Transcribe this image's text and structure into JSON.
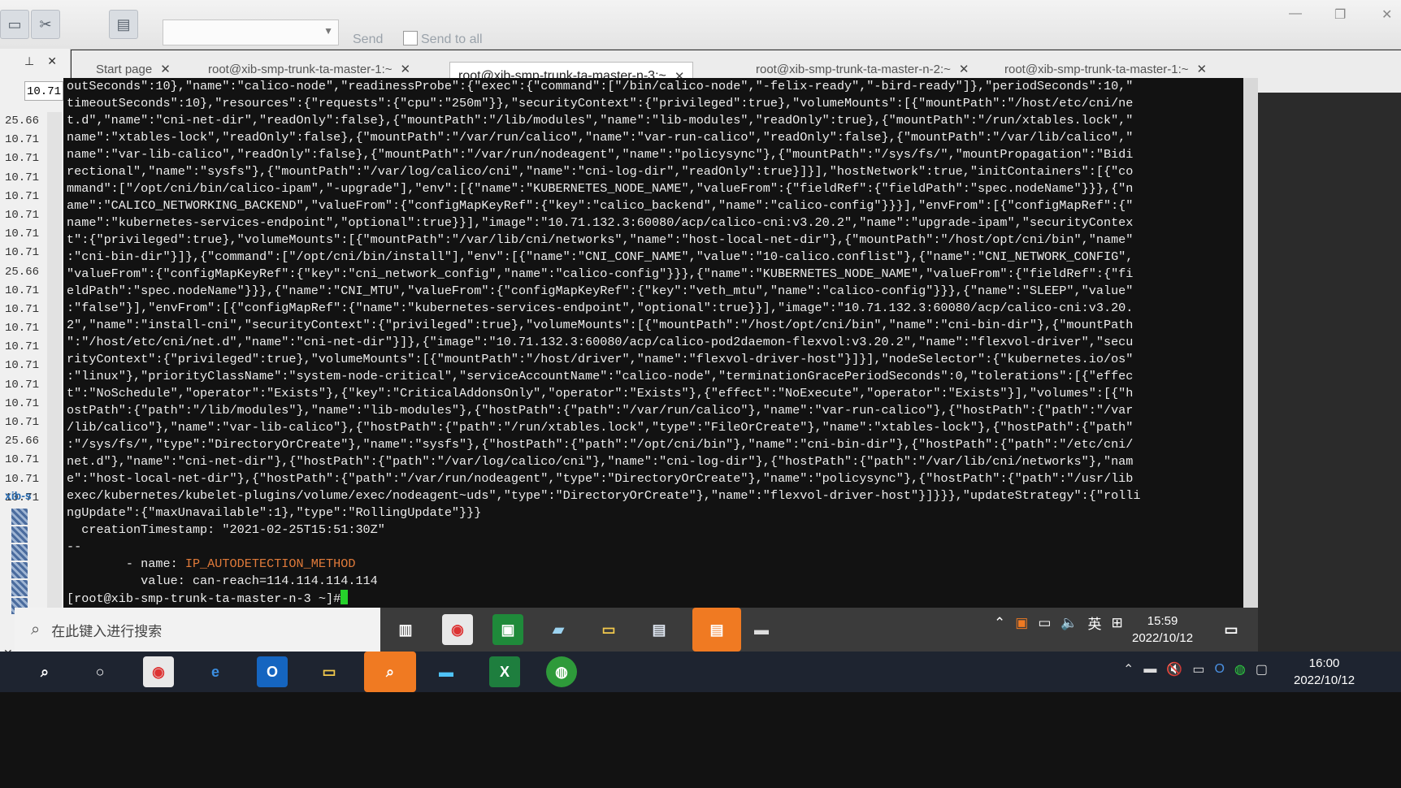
{
  "toolbar": {
    "send_label": "Send",
    "send_to_all_label": "Send to all"
  },
  "tabs": [
    {
      "label": "Start page"
    },
    {
      "label": "root@xib-smp-trunk-ta-master-1:~"
    },
    {
      "label": "root@xib-smp-trunk-ta-master-n-3:~"
    },
    {
      "label": "root@xib-smp-trunk-ta-master-n-2:~"
    },
    {
      "label": "root@xib-smp-trunk-ta-master-1:~"
    }
  ],
  "left_panel": {
    "input_value": "10.71",
    "items": [
      "25.66",
      "10.71",
      "10.71",
      "10.71",
      "10.71",
      "10.71",
      "10.71",
      "10.71",
      "25.66",
      "10.71",
      "10.71",
      "10.71",
      "10.71",
      "10.71",
      "10.71",
      "10.71",
      "10.71",
      "25.66",
      "10.71",
      "10.71",
      "10.71"
    ],
    "host_label": "xib-s"
  },
  "terminal": {
    "lines": [
      "outSeconds\":10},\"name\":\"calico-node\",\"readinessProbe\":{\"exec\":{\"command\":[\"/bin/calico-node\",\"-felix-ready\",\"-bird-ready\"]},\"periodSeconds\":10,\"",
      "timeoutSeconds\":10},\"resources\":{\"requests\":{\"cpu\":\"250m\"}},\"securityContext\":{\"privileged\":true},\"volumeMounts\":[{\"mountPath\":\"/host/etc/cni/ne",
      "t.d\",\"name\":\"cni-net-dir\",\"readOnly\":false},{\"mountPath\":\"/lib/modules\",\"name\":\"lib-modules\",\"readOnly\":true},{\"mountPath\":\"/run/xtables.lock\",\"",
      "name\":\"xtables-lock\",\"readOnly\":false},{\"mountPath\":\"/var/run/calico\",\"name\":\"var-run-calico\",\"readOnly\":false},{\"mountPath\":\"/var/lib/calico\",\"",
      "name\":\"var-lib-calico\",\"readOnly\":false},{\"mountPath\":\"/var/run/nodeagent\",\"name\":\"policysync\"},{\"mountPath\":\"/sys/fs/\",\"mountPropagation\":\"Bidi",
      "rectional\",\"name\":\"sysfs\"},{\"mountPath\":\"/var/log/calico/cni\",\"name\":\"cni-log-dir\",\"readOnly\":true}]}],\"hostNetwork\":true,\"initContainers\":[{\"co",
      "mmand\":[\"/opt/cni/bin/calico-ipam\",\"-upgrade\"],\"env\":[{\"name\":\"KUBERNETES_NODE_NAME\",\"valueFrom\":{\"fieldRef\":{\"fieldPath\":\"spec.nodeName\"}}},{\"n",
      "ame\":\"CALICO_NETWORKING_BACKEND\",\"valueFrom\":{\"configMapKeyRef\":{\"key\":\"calico_backend\",\"name\":\"calico-config\"}}}],\"envFrom\":[{\"configMapRef\":{\"",
      "name\":\"kubernetes-services-endpoint\",\"optional\":true}}],\"image\":\"10.71.132.3:60080/acp/calico-cni:v3.20.2\",\"name\":\"upgrade-ipam\",\"securityContex",
      "t\":{\"privileged\":true},\"volumeMounts\":[{\"mountPath\":\"/var/lib/cni/networks\",\"name\":\"host-local-net-dir\"},{\"mountPath\":\"/host/opt/cni/bin\",\"name\"",
      ":\"cni-bin-dir\"}]},{\"command\":[\"/opt/cni/bin/install\"],\"env\":[{\"name\":\"CNI_CONF_NAME\",\"value\":\"10-calico.conflist\"},{\"name\":\"CNI_NETWORK_CONFIG\",",
      "\"valueFrom\":{\"configMapKeyRef\":{\"key\":\"cni_network_config\",\"name\":\"calico-config\"}}},{\"name\":\"KUBERNETES_NODE_NAME\",\"valueFrom\":{\"fieldRef\":{\"fi",
      "eldPath\":\"spec.nodeName\"}}},{\"name\":\"CNI_MTU\",\"valueFrom\":{\"configMapKeyRef\":{\"key\":\"veth_mtu\",\"name\":\"calico-config\"}}},{\"name\":\"SLEEP\",\"value\"",
      ":\"false\"}],\"envFrom\":[{\"configMapRef\":{\"name\":\"kubernetes-services-endpoint\",\"optional\":true}}],\"image\":\"10.71.132.3:60080/acp/calico-cni:v3.20.",
      "2\",\"name\":\"install-cni\",\"securityContext\":{\"privileged\":true},\"volumeMounts\":[{\"mountPath\":\"/host/opt/cni/bin\",\"name\":\"cni-bin-dir\"},{\"mountPath",
      "\":\"/host/etc/cni/net.d\",\"name\":\"cni-net-dir\"}]},{\"image\":\"10.71.132.3:60080/acp/calico-pod2daemon-flexvol:v3.20.2\",\"name\":\"flexvol-driver\",\"secu",
      "rityContext\":{\"privileged\":true},\"volumeMounts\":[{\"mountPath\":\"/host/driver\",\"name\":\"flexvol-driver-host\"}]}],\"nodeSelector\":{\"kubernetes.io/os\"",
      ":\"linux\"},\"priorityClassName\":\"system-node-critical\",\"serviceAccountName\":\"calico-node\",\"terminationGracePeriodSeconds\":0,\"tolerations\":[{\"effec",
      "t\":\"NoSchedule\",\"operator\":\"Exists\"},{\"key\":\"CriticalAddonsOnly\",\"operator\":\"Exists\"},{\"effect\":\"NoExecute\",\"operator\":\"Exists\"}],\"volumes\":[{\"h",
      "ostPath\":{\"path\":\"/lib/modules\"},\"name\":\"lib-modules\"},{\"hostPath\":{\"path\":\"/var/run/calico\"},\"name\":\"var-run-calico\"},{\"hostPath\":{\"path\":\"/var",
      "/lib/calico\"},\"name\":\"var-lib-calico\"},{\"hostPath\":{\"path\":\"/run/xtables.lock\",\"type\":\"FileOrCreate\"},\"name\":\"xtables-lock\"},{\"hostPath\":{\"path\"",
      ":\"/sys/fs/\",\"type\":\"DirectoryOrCreate\"},\"name\":\"sysfs\"},{\"hostPath\":{\"path\":\"/opt/cni/bin\"},\"name\":\"cni-bin-dir\"},{\"hostPath\":{\"path\":\"/etc/cni/",
      "net.d\"},\"name\":\"cni-net-dir\"},{\"hostPath\":{\"path\":\"/var/log/calico/cni\"},\"name\":\"cni-log-dir\"},{\"hostPath\":{\"path\":\"/var/lib/cni/networks\"},\"nam",
      "e\":\"host-local-net-dir\"},{\"hostPath\":{\"path\":\"/var/run/nodeagent\",\"type\":\"DirectoryOrCreate\"},\"name\":\"policysync\"},{\"hostPath\":{\"path\":\"/usr/lib",
      "exec/kubernetes/kubelet-plugins/volume/exec/nodeagent~uds\",\"type\":\"DirectoryOrCreate\"},\"name\":\"flexvol-driver-host\"}]}}},\"updateStrategy\":{\"rolli",
      "ngUpdate\":{\"maxUnavailable\":1},\"type\":\"RollingUpdate\"}}}",
      "  creationTimestamp: \"2021-02-25T15:51:30Z\"",
      "--"
    ],
    "name_line_prefix": "        - name: ",
    "name_line_value": "IP_AUTODETECTION_METHOD",
    "value_line": "          value: can-reach=114.114.114.114",
    "prompt": "[root@xib-smp-trunk-ta-master-n-3 ~]#"
  },
  "taskbar_remote": {
    "search_placeholder": "在此键入进行搜索",
    "ime_label": "英",
    "time": "15:59",
    "date": "2022/10/12"
  },
  "taskbar_local": {
    "time": "16:00",
    "date": "2022/10/12"
  }
}
